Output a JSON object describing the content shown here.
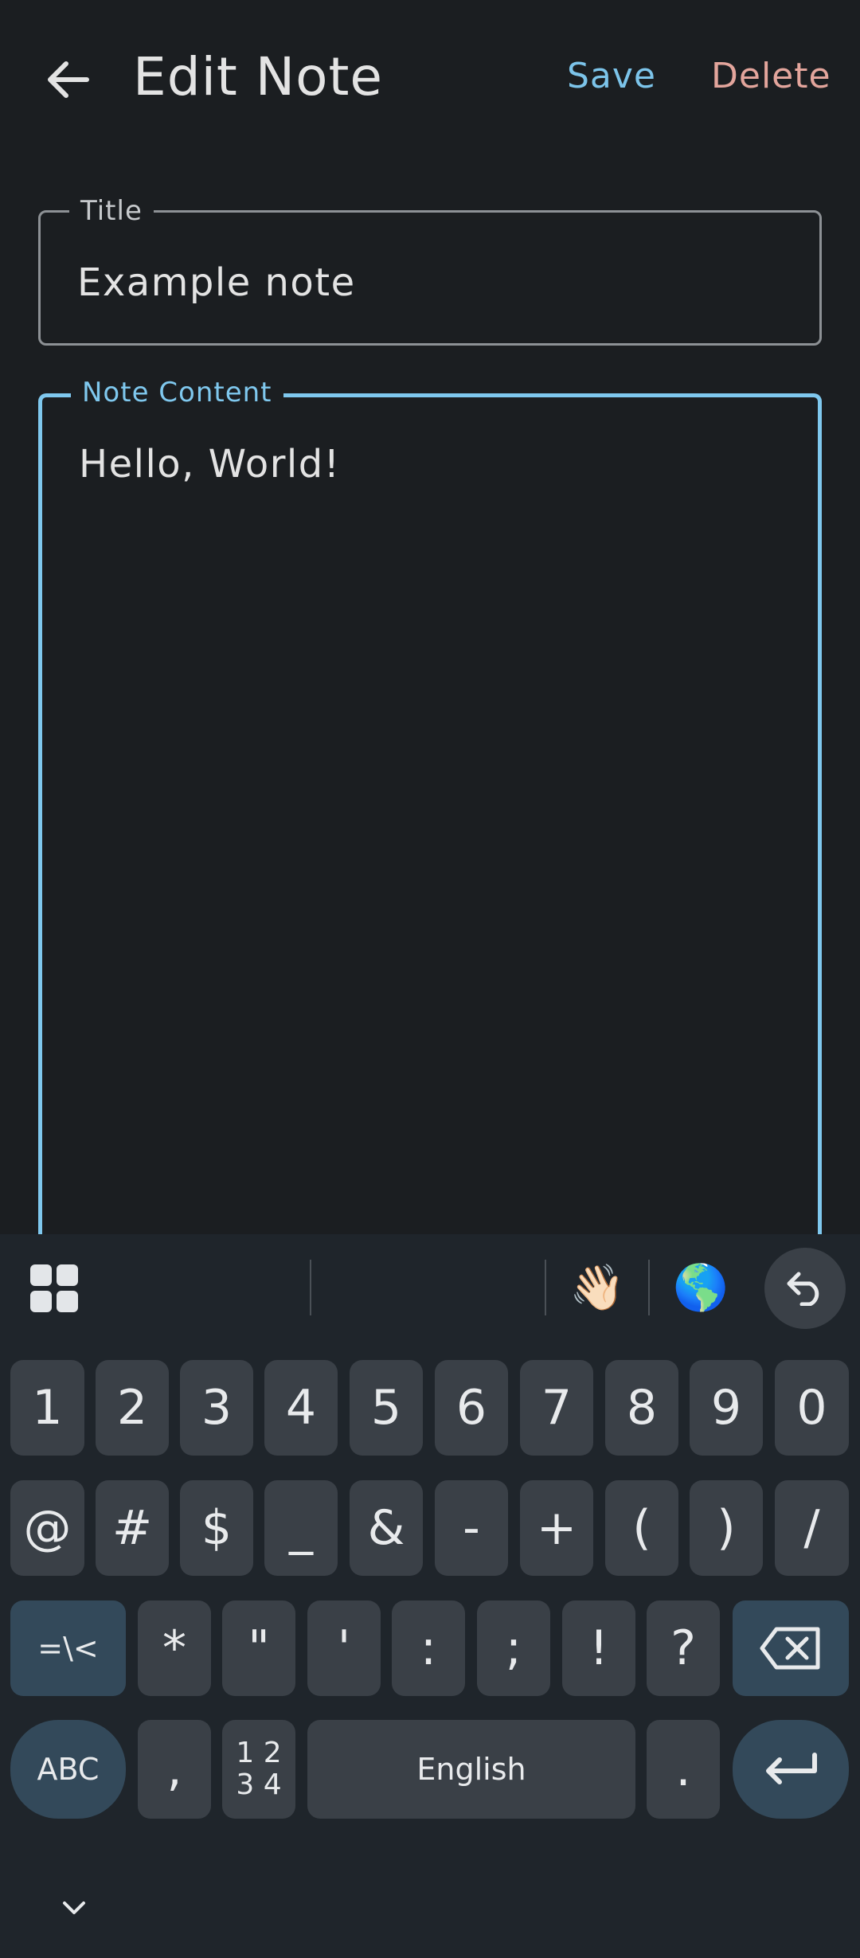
{
  "header": {
    "title": "Edit Note",
    "save_label": "Save",
    "delete_label": "Delete",
    "back_icon": "arrow-left-icon"
  },
  "form": {
    "title_label": "Title",
    "title_value": "Example note",
    "content_label": "Note Content",
    "content_value": "Hello, World!"
  },
  "keyboard": {
    "toolbar": {
      "apps_icon": "apps-grid-icon",
      "wave_emoji": "👋🏻",
      "globe_emoji": "🌎",
      "undo_icon": "undo-icon"
    },
    "row1": [
      "1",
      "2",
      "3",
      "4",
      "5",
      "6",
      "7",
      "8",
      "9",
      "0"
    ],
    "row2": [
      "@",
      "#",
      "$",
      "_",
      "&",
      "-",
      "+",
      "(",
      ")",
      "/"
    ],
    "row3_symbols_key": "=\\<",
    "row3": [
      "*",
      "\"",
      "'",
      ":",
      ";",
      "!",
      "?"
    ],
    "row4": {
      "abc": "ABC",
      "comma": ",",
      "numpad_top": "1 2",
      "numpad_bottom": "3 4",
      "space": "English",
      "period": "."
    },
    "collapse_icon": "chevron-down-icon"
  },
  "colors": {
    "background": "#1b1e21",
    "accent": "#7fc8ee",
    "delete": "#e3a59c",
    "keyboard_bg": "#1f252b",
    "key_bg": "#3a4047",
    "special_key_bg": "#33495a"
  }
}
